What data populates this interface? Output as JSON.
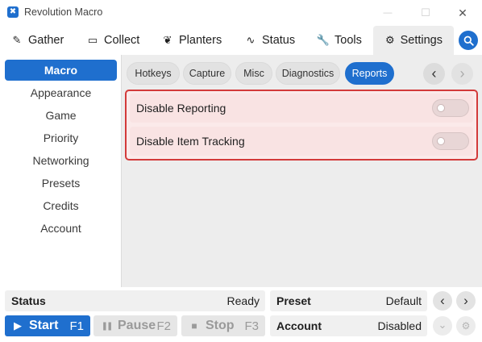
{
  "window": {
    "title": "Revolution Macro",
    "logo_glyph": "✖",
    "controls": {
      "minimize": "—",
      "maximize": "☐",
      "close": "✕"
    }
  },
  "main_tabs": [
    {
      "label": "Gather",
      "icon": "✎"
    },
    {
      "label": "Collect",
      "icon": "▭"
    },
    {
      "label": "Planters",
      "icon": "❦"
    },
    {
      "label": "Status",
      "icon": "∿"
    },
    {
      "label": "Tools",
      "icon": "🔧"
    },
    {
      "label": "Settings",
      "icon": "⚙",
      "active": true
    }
  ],
  "sidebar": {
    "items": [
      {
        "label": "Macro",
        "active": true
      },
      {
        "label": "Appearance"
      },
      {
        "label": "Game"
      },
      {
        "label": "Priority"
      },
      {
        "label": "Networking"
      },
      {
        "label": "Presets"
      },
      {
        "label": "Credits"
      },
      {
        "label": "Account"
      }
    ]
  },
  "sub_tabs": [
    {
      "label": "Hotkeys"
    },
    {
      "label": "Capture"
    },
    {
      "label": "Misc"
    },
    {
      "label": "Diagnostics"
    },
    {
      "label": "Reports",
      "active": true
    }
  ],
  "sub_nav": {
    "prev": "‹",
    "next": "›"
  },
  "reports": {
    "rows": [
      {
        "label": "Disable Reporting",
        "enabled": false
      },
      {
        "label": "Disable Item Tracking",
        "enabled": false
      }
    ]
  },
  "bottom": {
    "status": {
      "label": "Status",
      "value": "Ready"
    },
    "preset": {
      "label": "Preset",
      "value": "Default"
    },
    "account": {
      "label": "Account",
      "value": "Disabled"
    },
    "buttons": {
      "start": {
        "label": "Start",
        "key": "F1",
        "icon": "▶"
      },
      "pause": {
        "label": "Pause",
        "key": "F2",
        "icon": "❚❚"
      },
      "stop": {
        "label": "Stop",
        "key": "F3",
        "icon": "■"
      }
    },
    "preset_nav": {
      "prev": "‹",
      "next": "›"
    },
    "account_controls": {
      "dropdown": "⌄",
      "settings": "⚙"
    }
  },
  "colors": {
    "accent": "#1f6fce",
    "highlight_border": "#d33a3a",
    "highlight_bg": "#fbeaea",
    "content_bg": "#ededed"
  }
}
